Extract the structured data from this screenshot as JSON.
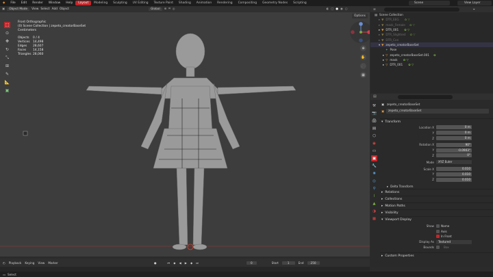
{
  "menu": [
    "File",
    "Edit",
    "Render",
    "Window",
    "Help"
  ],
  "workspaces": [
    "Layout",
    "Modeling",
    "Sculpting",
    "UV Editing",
    "Texture Paint",
    "Shading",
    "Animation",
    "Rendering",
    "Compositing",
    "Geometry Nodes",
    "Scripting"
  ],
  "scene_label": "Scene",
  "view_layer_label": "View Layer",
  "header": {
    "mode": "Object Mode",
    "view": "View",
    "select": "Select",
    "add": "Add",
    "object": "Object",
    "orientation": "Global",
    "options": "Options"
  },
  "overlay": {
    "view_name": "Front Orthographic",
    "collection_path": "(0) Scene Collection | zepeto_creatorBaseSet",
    "units": "Centimeters",
    "stats": [
      {
        "label": "Objects",
        "value": "0 / 4"
      },
      {
        "label": "Vertices",
        "value": "14,498"
      },
      {
        "label": "Edges",
        "value": "28,607"
      },
      {
        "label": "Faces",
        "value": "14,158"
      },
      {
        "label": "Triangles",
        "value": "28,060"
      }
    ]
  },
  "outliner": {
    "scene_collection": "Scene Collection",
    "items": [
      {
        "name": "DTR_EEG",
        "dim": true
      },
      {
        "name": "mask_Female",
        "dim": true
      },
      {
        "name": "DTR_001",
        "dim": false
      },
      {
        "name": "DTR_Slightest",
        "dim": true
      },
      {
        "name": "DTR_Con",
        "dim": true
      },
      {
        "name": "zepeto_creatorBaseSet",
        "dim": false
      },
      {
        "name": "Pose",
        "dim": false
      },
      {
        "name": "zepeto_creatorBaseSet.001",
        "dim": false
      },
      {
        "name": "mask",
        "dim": false
      },
      {
        "name": "DTR_001",
        "dim": false
      }
    ]
  },
  "properties": {
    "object_name": "zepeto_creatorBaseSet",
    "object_field": "zepeto_creatorBaseSet",
    "transform_label": "Transform",
    "location": [
      {
        "label": "Location X",
        "value": "0 m"
      },
      {
        "label": "Y",
        "value": "0 m"
      },
      {
        "label": "Z",
        "value": "0 m"
      }
    ],
    "rotation": [
      {
        "label": "Rotation X",
        "value": "90°"
      },
      {
        "label": "Y",
        "value": "-0.0903°"
      },
      {
        "label": "Z",
        "value": "0°"
      }
    ],
    "mode_label": "Mode",
    "mode_value": "XYZ Euler",
    "scale": [
      {
        "label": "Scale X",
        "value": "0.010"
      },
      {
        "label": "Y",
        "value": "0.010"
      },
      {
        "label": "Z",
        "value": "0.010"
      }
    ],
    "delta_label": "Delta Transform",
    "sections": [
      "Relations",
      "Collections",
      "Motion Paths",
      "Visibility"
    ],
    "viewport_display": "Viewport Display",
    "show_label": "Show",
    "show_items": [
      "Name",
      "Axis",
      "In Front"
    ],
    "display_as_label": "Display As",
    "display_as_value": "Textured",
    "bounds_label": "Bounds",
    "bounds_value": "Box",
    "custom_props": "Custom Properties"
  },
  "timeline": {
    "playback": "Playback",
    "keying": "Keying",
    "view": "View",
    "marker": "Marker",
    "current_frame": "0",
    "start_label": "Start",
    "start": "1",
    "end_label": "End",
    "end": "250"
  },
  "status": {
    "select": "Select"
  }
}
